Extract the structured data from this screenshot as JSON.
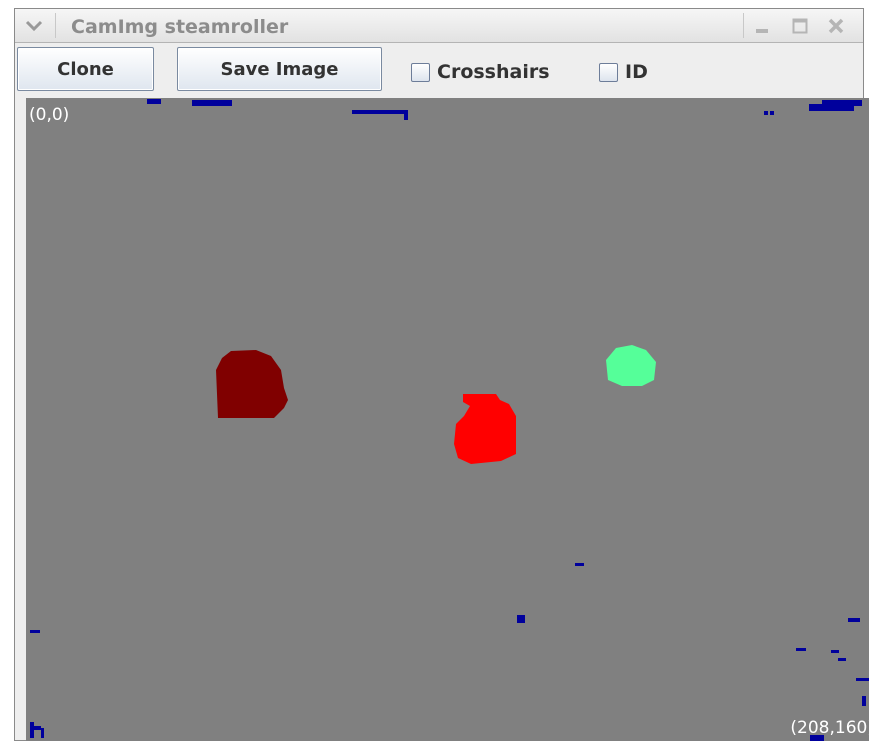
{
  "window": {
    "title": "CamImg steamroller"
  },
  "toolbar": {
    "clone_label": "Clone",
    "save_label": "Save Image",
    "crosshairs_label": "Crosshairs",
    "id_label": "ID"
  },
  "canvas": {
    "top_left_label": "(0,0)",
    "bottom_right_label": "(208,160)",
    "background_color": "#808080",
    "blob_colors": [
      "#800000",
      "#ff0000",
      "#55ff99"
    ],
    "noise_color": "#00009c"
  }
}
